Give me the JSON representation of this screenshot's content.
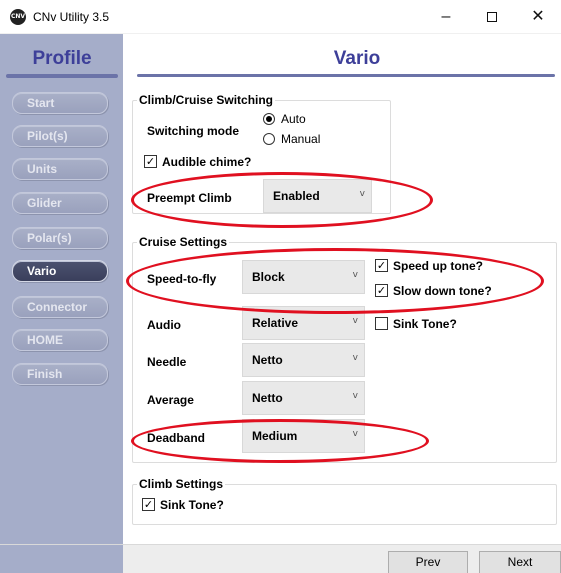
{
  "window": {
    "title": "CNv Utility 3.5",
    "icon_label": "CNV",
    "minimize": "–",
    "close": "✕"
  },
  "sidebar": {
    "title": "Profile",
    "items": [
      {
        "label": "Start",
        "active": false
      },
      {
        "label": "Pilot(s)",
        "active": false
      },
      {
        "label": "Units",
        "active": false
      },
      {
        "label": "Glider",
        "active": false
      },
      {
        "label": "Polar(s)",
        "active": false
      },
      {
        "label": "Vario",
        "active": true
      },
      {
        "label": "Connector",
        "active": false
      },
      {
        "label": "HOME",
        "active": false
      },
      {
        "label": "Finish",
        "active": false
      }
    ]
  },
  "page": {
    "title": "Vario"
  },
  "climb_cruise": {
    "legend": "Climb/Cruise Switching",
    "switching_mode_label": "Switching mode",
    "option_auto": "Auto",
    "option_manual": "Manual",
    "selected": "Auto",
    "audible_chime_label": "Audible chime?",
    "audible_chime_checked": true,
    "preempt_label": "Preempt Climb",
    "preempt_value": "Enabled"
  },
  "cruise": {
    "legend": "Cruise Settings",
    "speed_to_fly_label": "Speed-to-fly",
    "speed_to_fly_value": "Block",
    "audio_label": "Audio",
    "audio_value": "Relative",
    "needle_label": "Needle",
    "needle_value": "Netto",
    "average_label": "Average",
    "average_value": "Netto",
    "deadband_label": "Deadband",
    "deadband_value": "Medium",
    "speed_up_label": "Speed up tone?",
    "speed_up_checked": true,
    "slow_down_label": "Slow down tone?",
    "slow_down_checked": true,
    "sink_tone_label": "Sink Tone?",
    "sink_tone_checked": false
  },
  "climb": {
    "legend": "Climb Settings",
    "sink_tone_label": "Sink Tone?",
    "sink_tone_checked": true
  },
  "footer": {
    "prev": "Prev",
    "next": "Next"
  },
  "glyphs": {
    "check": "✓",
    "dropdown": "v"
  },
  "colors": {
    "sidebar_bg": "#a5adc9",
    "title_color": "#3d3f99",
    "active_nav": "#3a3f5c",
    "annotation_red": "#e01020"
  }
}
